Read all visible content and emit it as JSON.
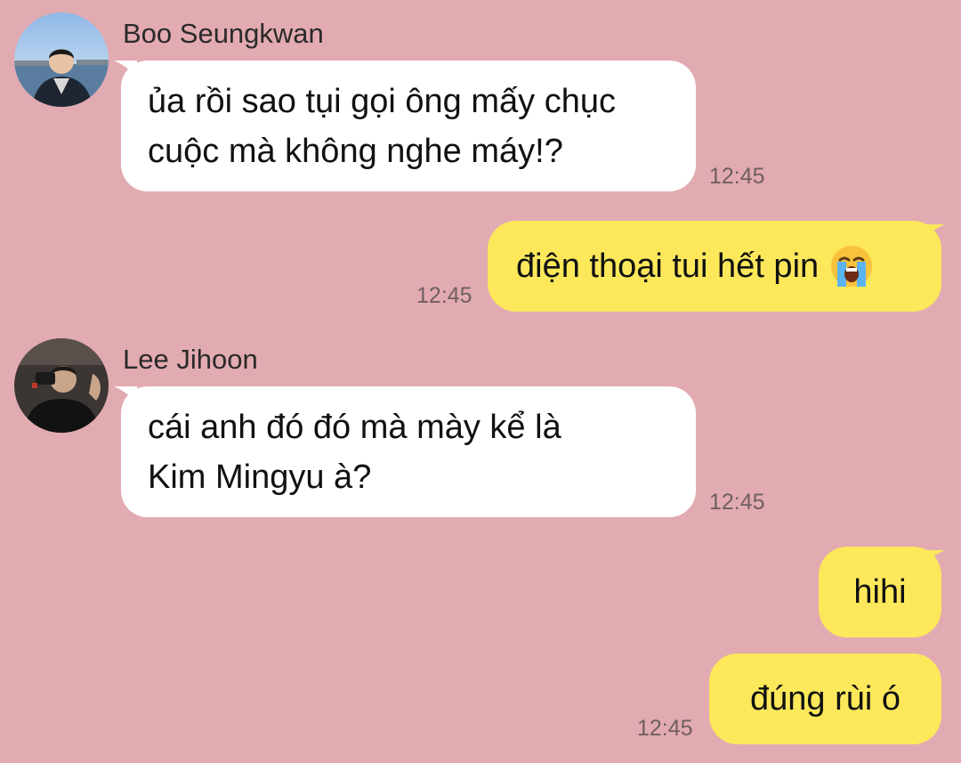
{
  "colors": {
    "background": "#E2ABB1",
    "incoming_bubble": "#FFFFFF",
    "outgoing_bubble": "#FCE85A"
  },
  "messages": [
    {
      "sender": "Boo Seungkwan",
      "direction": "incoming",
      "lines": [
        "ủa rồi sao tụi gọi ông mấy chục",
        "cuộc mà không nghe máy!?"
      ],
      "time": "12:45"
    },
    {
      "direction": "outgoing",
      "text": "điện thoại tui hết pin",
      "emoji": "😭",
      "emoji_icon": "loudly-crying-face-icon",
      "time": "12:45"
    },
    {
      "sender": "Lee Jihoon",
      "direction": "incoming",
      "lines": [
        "cái anh đó đó mà mày kể là",
        "Kim Mingyu à?"
      ],
      "time": "12:45"
    },
    {
      "direction": "outgoing",
      "text": "hihi"
    },
    {
      "direction": "outgoing",
      "text": "đúng rùi ó",
      "time": "12:45"
    }
  ]
}
